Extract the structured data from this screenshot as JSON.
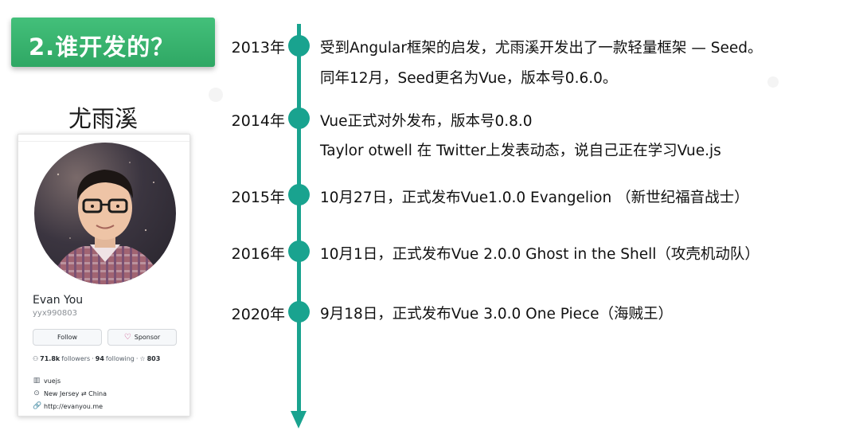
{
  "section_title": "2.谁开发的？",
  "person_name": "尤雨溪",
  "profile": {
    "display_name": "Evan You",
    "username": "yyx990803",
    "follow_label": "Follow",
    "sponsor_label": "Sponsor",
    "followers_count": "71.8k",
    "followers_label": "followers",
    "following_count": "94",
    "following_label": "following",
    "stars_count": "803",
    "organization": "vuejs",
    "location": "New Jersey ⇄ China",
    "website": "http://evanyou.me"
  },
  "timeline": {
    "color": "#19a38f",
    "events": [
      {
        "year": "2013年",
        "lines": [
          "受到Angular框架的启发，尤雨溪开发出了一款轻量框架 — Seed。",
          "同年12月，Seed更名为Vue，版本号0.6.0。"
        ]
      },
      {
        "year": "2014年",
        "lines": [
          "Vue正式对外发布，版本号0.8.0",
          "Taylor otwell 在 Twitter上发表动态，说自己正在学习Vue.js"
        ]
      },
      {
        "year": "2015年",
        "lines": [
          "10月27日，正式发布Vue1.0.0 Evangelion （新世纪福音战士）"
        ]
      },
      {
        "year": "2016年",
        "lines": [
          "10月1日，正式发布Vue 2.0.0 Ghost in the Shell（攻壳机动队）"
        ]
      },
      {
        "year": "2020年",
        "lines": [
          "9月18日，正式发布Vue 3.0.0 One Piece（海贼王）"
        ]
      }
    ]
  },
  "colors": {
    "banner": "#3bb570",
    "timeline": "#19a38f",
    "heart": "#c3347a"
  }
}
